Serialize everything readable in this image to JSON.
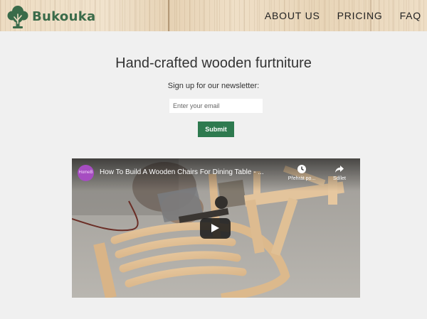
{
  "header": {
    "brand": "Bukouka",
    "nav": [
      {
        "label": "ABOUT US"
      },
      {
        "label": "PRICING"
      },
      {
        "label": "FAQ"
      }
    ]
  },
  "main": {
    "title": "Hand-crafted wooden furtniture",
    "newsletter_prompt": "Sign up for our newsletter:",
    "email_placeholder": "Enter your email",
    "submit_label": "Submit"
  },
  "video": {
    "channel_initials": "HomeB",
    "title": "How To Build A Wooden Chairs For Dining Table - ...",
    "watch_later_label": "Přehrát po...",
    "share_label": "Sdílet"
  },
  "colors": {
    "brand_green": "#3a6b4a",
    "button_green": "#2e7a4f",
    "page_bg": "#f0f0f0",
    "avatar_purple": "#a64dc1"
  }
}
